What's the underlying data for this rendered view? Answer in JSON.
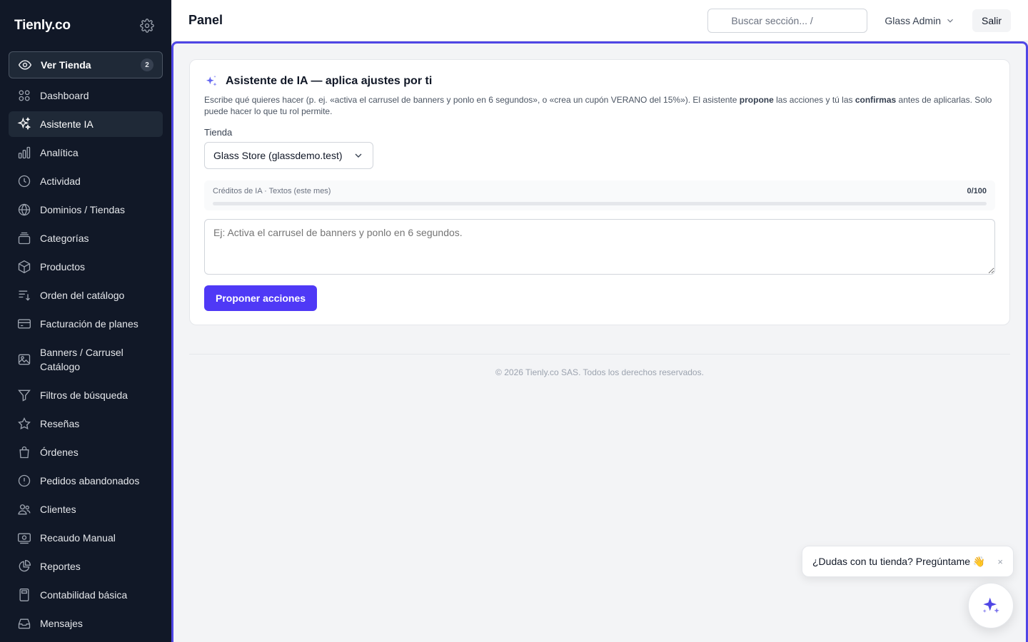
{
  "sidebar": {
    "brand": "Tienly.co",
    "view_store": {
      "label": "Ver Tienda",
      "badge": "2"
    },
    "items": [
      {
        "label": "Dashboard",
        "icon": "grid-icon"
      },
      {
        "label": "Asistente IA",
        "icon": "sparkles-icon",
        "active": true
      },
      {
        "label": "Analítica",
        "icon": "bar-chart-icon"
      },
      {
        "label": "Actividad",
        "icon": "clock-icon"
      },
      {
        "label": "Dominios / Tiendas",
        "icon": "globe-icon"
      },
      {
        "label": "Categorías",
        "icon": "stack-icon"
      },
      {
        "label": "Productos",
        "icon": "box-icon"
      },
      {
        "label": "Orden del catálogo",
        "icon": "sort-icon"
      },
      {
        "label": "Facturación de planes",
        "icon": "credit-card-icon"
      },
      {
        "label": "Banners / Carrusel Catálogo",
        "icon": "image-icon"
      },
      {
        "label": "Filtros de búsqueda",
        "icon": "filter-icon"
      },
      {
        "label": "Reseñas",
        "icon": "star-icon"
      },
      {
        "label": "Órdenes",
        "icon": "shopping-bag-icon"
      },
      {
        "label": "Pedidos abandonados",
        "icon": "alert-circle-icon"
      },
      {
        "label": "Clientes",
        "icon": "users-icon"
      },
      {
        "label": "Recaudo Manual",
        "icon": "cash-icon"
      },
      {
        "label": "Reportes",
        "icon": "pie-chart-icon"
      },
      {
        "label": "Contabilidad básica",
        "icon": "calculator-icon"
      },
      {
        "label": "Mensajes",
        "icon": "inbox-icon"
      }
    ]
  },
  "header": {
    "title": "Panel",
    "search_placeholder": "Buscar sección...  /",
    "user": "Glass Admin",
    "logout": "Salir"
  },
  "assistant": {
    "title": "Asistente de IA — aplica ajustes por ti",
    "desc_part1": "Escribe qué quieres hacer (p. ej. «activa el carrusel de banners y ponlo en 6 segundos», o «crea un cupón VERANO del 15%»). El asistente ",
    "desc_bold1": "propone",
    "desc_part2": " las acciones y tú las ",
    "desc_bold2": "confirmas",
    "desc_part3": " antes de aplicarlas. Solo puede hacer lo que tu rol permite.",
    "store_label": "Tienda",
    "store_value": "Glass Store (glassdemo.test)",
    "credits_label": "Créditos de IA · Textos (este mes)",
    "credits_count": "0/100",
    "credits_used_fraction": 0,
    "textarea_placeholder": "Ej: Activa el carrusel de banners y ponlo en 6 segundos.",
    "submit": "Proponer acciones"
  },
  "footer": {
    "text": "© 2026 Tienly.co SAS. Todos los derechos reservados."
  },
  "chat": {
    "prompt": "¿Dudas con tu tienda? Pregúntame 👋",
    "close": "×"
  },
  "colors": {
    "accent": "#4f46e5",
    "sidebar_bg": "#111827"
  }
}
